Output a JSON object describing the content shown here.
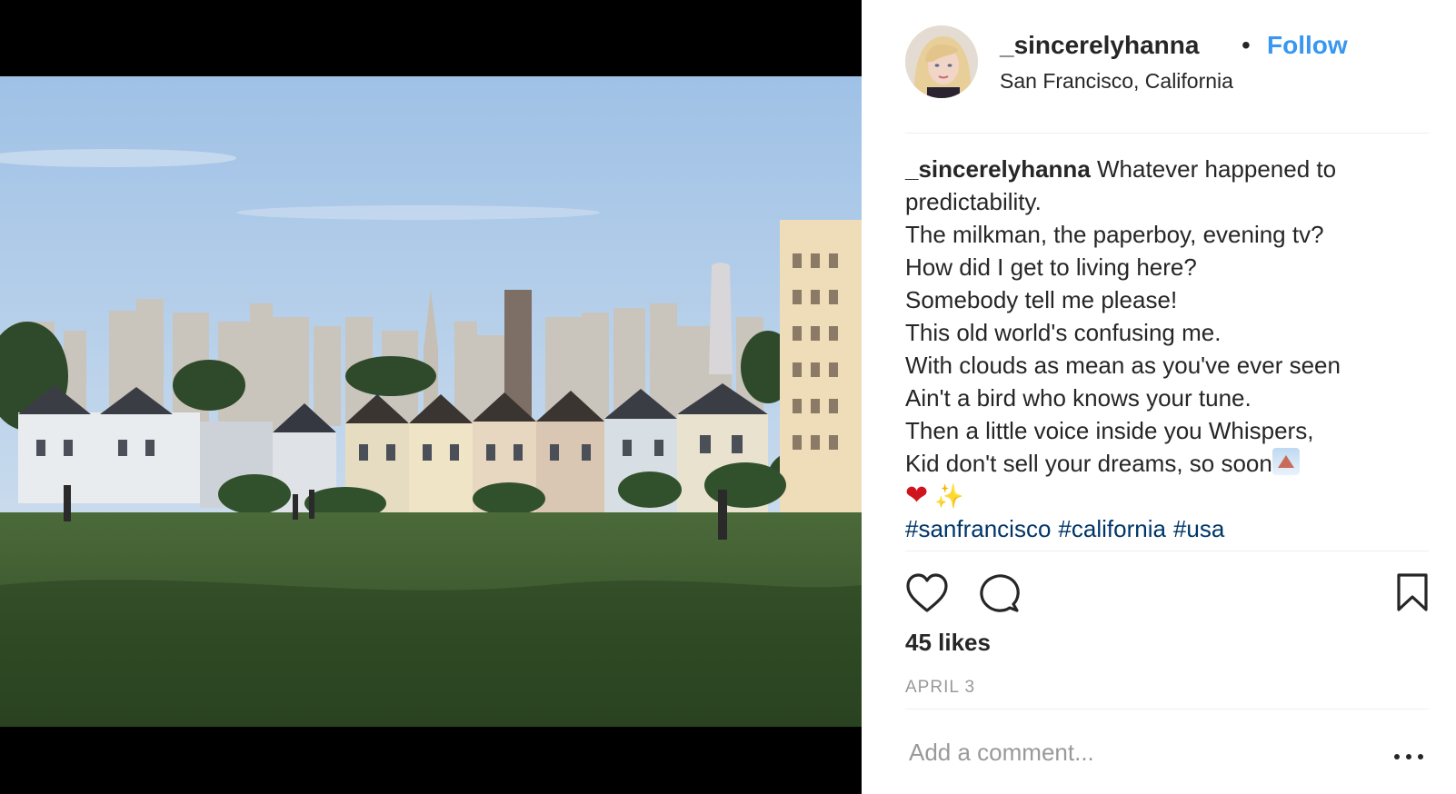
{
  "post": {
    "username": "_sincerelyhanna",
    "separator": "•",
    "follow_label": "Follow",
    "location": "San Francisco, California"
  },
  "caption": {
    "username": "_sincerelyhanna",
    "lines": [
      "Whatever happened to",
      "predictability.",
      "The milkman, the paperboy, evening tv?",
      "How did I get to living here?",
      "Somebody tell me please!",
      "This old world's confusing me.",
      "With clouds as mean as you've ever seen",
      "Ain't a bird who knows your tune.",
      "Then a little voice inside you Whispers,",
      "Kid don't sell your dreams, so soon"
    ],
    "emoji_line": {
      "heart": "❤",
      "sparkles": "✨"
    },
    "hashtags": [
      "#sanfrancisco",
      "#california",
      "#usa"
    ]
  },
  "stats": {
    "likes": "45 likes",
    "date": "APRIL 3"
  },
  "comment": {
    "placeholder": "Add a comment..."
  },
  "icons": {
    "like": "heart-outline-icon",
    "comment": "speech-bubble-icon",
    "save": "bookmark-icon",
    "more": "more-options-icon"
  },
  "colors": {
    "follow": "#3897f0",
    "hashtag": "#003569",
    "muted": "#999999",
    "text": "#262626"
  }
}
